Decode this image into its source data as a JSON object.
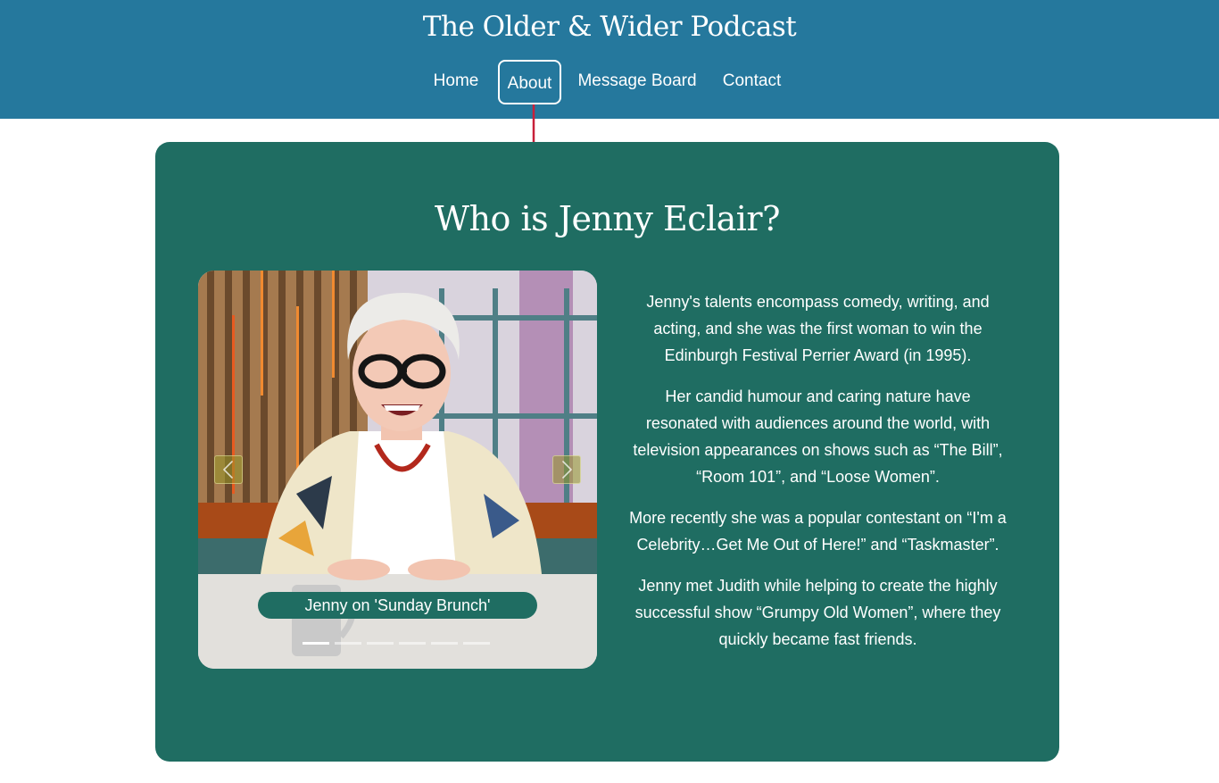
{
  "header": {
    "site_title": "The Older & Wider Podcast",
    "nav": [
      {
        "label": "Home"
      },
      {
        "label": "About",
        "active": true
      },
      {
        "label": "Message Board"
      },
      {
        "label": "Contact"
      }
    ]
  },
  "about": {
    "heading": "Who is Jenny Eclair?",
    "carousel": {
      "caption": "Jenny on 'Sunday Brunch'",
      "slide_count": 6,
      "active_slide": 1,
      "prev_icon": "chevron-left-icon",
      "next_icon": "chevron-right-icon"
    },
    "paragraphs": [
      "Jenny's talents encompass comedy, writing, and acting, and she was the first woman to win the Edinburgh Festival Perrier Award (in 1995).",
      "Her candid humour and caring nature have resonated with audiences around the world, with television appearances on shows such as “The Bill”, “Room 101”, and “Loose Women”.",
      "More recently she was a popular contestant on “I'm a Celebrity…Get Me Out of Here!” and “Taskmaster”.",
      "Jenny met Judith while helping to create the highly successful show “Grumpy Old Women”, where they quickly became fast friends."
    ]
  },
  "colors": {
    "header_bg": "#25789d",
    "card_bg": "#1f6d62",
    "annotation_arrow": "#c8203a",
    "text": "#ffffff"
  }
}
